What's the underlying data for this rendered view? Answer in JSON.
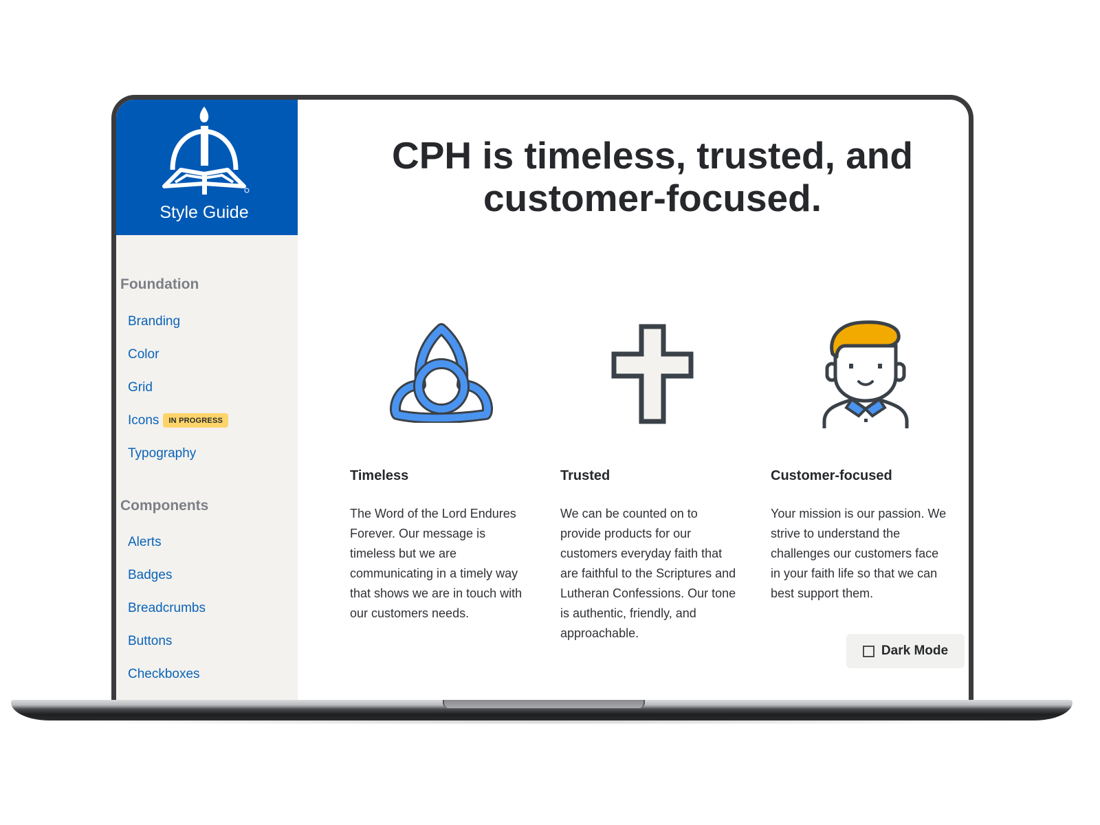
{
  "brand": {
    "title": "Style Guide",
    "logo_icon": "candle-book-logo"
  },
  "sidebar": {
    "sections": [
      {
        "heading": "Foundation",
        "items": [
          {
            "label": "Branding"
          },
          {
            "label": "Color"
          },
          {
            "label": "Grid"
          },
          {
            "label": "Icons",
            "badge": "IN PROGRESS"
          },
          {
            "label": "Typography"
          }
        ]
      },
      {
        "heading": "Components",
        "items": [
          {
            "label": "Alerts"
          },
          {
            "label": "Badges"
          },
          {
            "label": "Breadcrumbs"
          },
          {
            "label": "Buttons"
          },
          {
            "label": "Checkboxes"
          }
        ]
      }
    ]
  },
  "main": {
    "title_line1": "CPH is timeless, trusted, and",
    "title_line2": "customer-focused.",
    "values": [
      {
        "icon": "trinity-knot-icon",
        "heading": "Timeless",
        "lines": [
          "The Word of the Lord Endures",
          "Forever. Our message is",
          "timeless but we are",
          "communicating in a timely way",
          "that shows we are in touch with",
          "our customers needs."
        ]
      },
      {
        "icon": "cross-icon",
        "heading": "Trusted",
        "lines": [
          "We can be counted on to",
          "provide products for our",
          "customers everyday faith that",
          "are faithful to the Scriptures and",
          "Lutheran Confessions. Our tone",
          "is authentic, friendly, and",
          "approachable."
        ]
      },
      {
        "icon": "person-icon",
        "heading": "Customer-focused",
        "lines": [
          "Your mission is our passion. We",
          "strive to understand the",
          "challenges our customers face",
          "in your faith life so that we can",
          "best support them."
        ]
      }
    ]
  },
  "dark_mode": {
    "label": "Dark Mode",
    "checked": false
  },
  "colors": {
    "brand_blue": "#0059b5",
    "link_blue": "#0a63b8",
    "badge_yellow": "#fcd46a",
    "icon_blue": "#4a94f0",
    "hair_orange": "#f2a900"
  }
}
